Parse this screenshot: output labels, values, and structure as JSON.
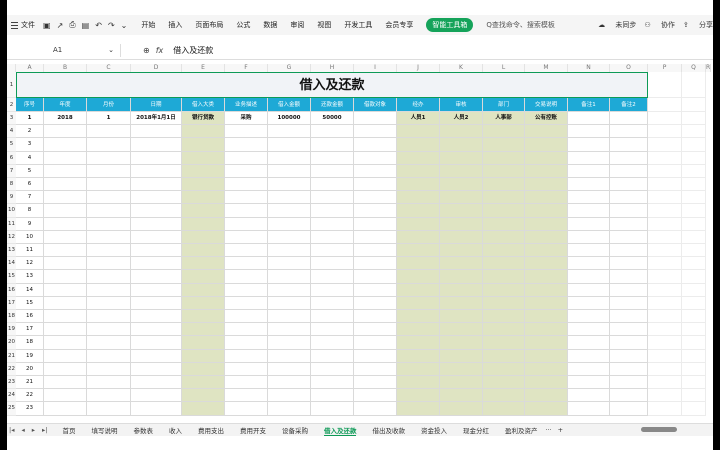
{
  "menubar": {
    "file_label": "文件",
    "menus": [
      "开始",
      "插入",
      "页面布局",
      "公式",
      "数据",
      "审阅",
      "视图",
      "开发工具",
      "会员专享"
    ],
    "active_menu": "智能工具箱",
    "search_placeholder": "Q查找命令、搜索模板",
    "sync_label": "未同步",
    "collab_label": "协作",
    "share_label": "分享"
  },
  "formula_bar": {
    "cell_ref": "A1",
    "fx_label": "fx",
    "value": "借入及还款"
  },
  "sheet": {
    "columns": [
      "A",
      "B",
      "C",
      "D",
      "E",
      "F",
      "G",
      "H",
      "I",
      "J",
      "K",
      "L",
      "M",
      "N",
      "O",
      "P",
      "Q",
      "R"
    ],
    "title": "借入及还款",
    "headers": [
      "序号",
      "年度",
      "月份",
      "日期",
      "借入大类",
      "业务描述",
      "借入金额",
      "还款金额",
      "借款对象",
      "经办",
      "审核",
      "部门",
      "交易说明",
      "备注1",
      "备注2"
    ],
    "first_row": [
      "1",
      "2018",
      "1",
      "2018年1月1日",
      "银行贷款",
      "采购",
      "100000",
      "50000",
      "",
      "人员1",
      "人员2",
      "人事部",
      "公有控账",
      "",
      ""
    ],
    "row_numbers": [
      "1",
      "2",
      "3",
      "4",
      "5",
      "6",
      "7",
      "8",
      "9",
      "10",
      "11",
      "12",
      "13",
      "14",
      "15",
      "16",
      "17",
      "18",
      "19",
      "20",
      "21",
      "22",
      "23",
      "24",
      "25"
    ],
    "serials": [
      "2",
      "3",
      "4",
      "5",
      "6",
      "7",
      "8",
      "9",
      "10",
      "11",
      "12",
      "13",
      "14",
      "15",
      "16",
      "17",
      "18",
      "19",
      "20",
      "21",
      "22",
      "23"
    ]
  },
  "tabs": {
    "items": [
      "首页",
      "填写说明",
      "参数表",
      "收入",
      "费用支出",
      "费用开支",
      "设备采购",
      "借入及还款",
      "借出及收款",
      "资金投入",
      "现金分红",
      "盈利及资产"
    ],
    "active": "借入及还款",
    "more": "···",
    "add": "+"
  }
}
